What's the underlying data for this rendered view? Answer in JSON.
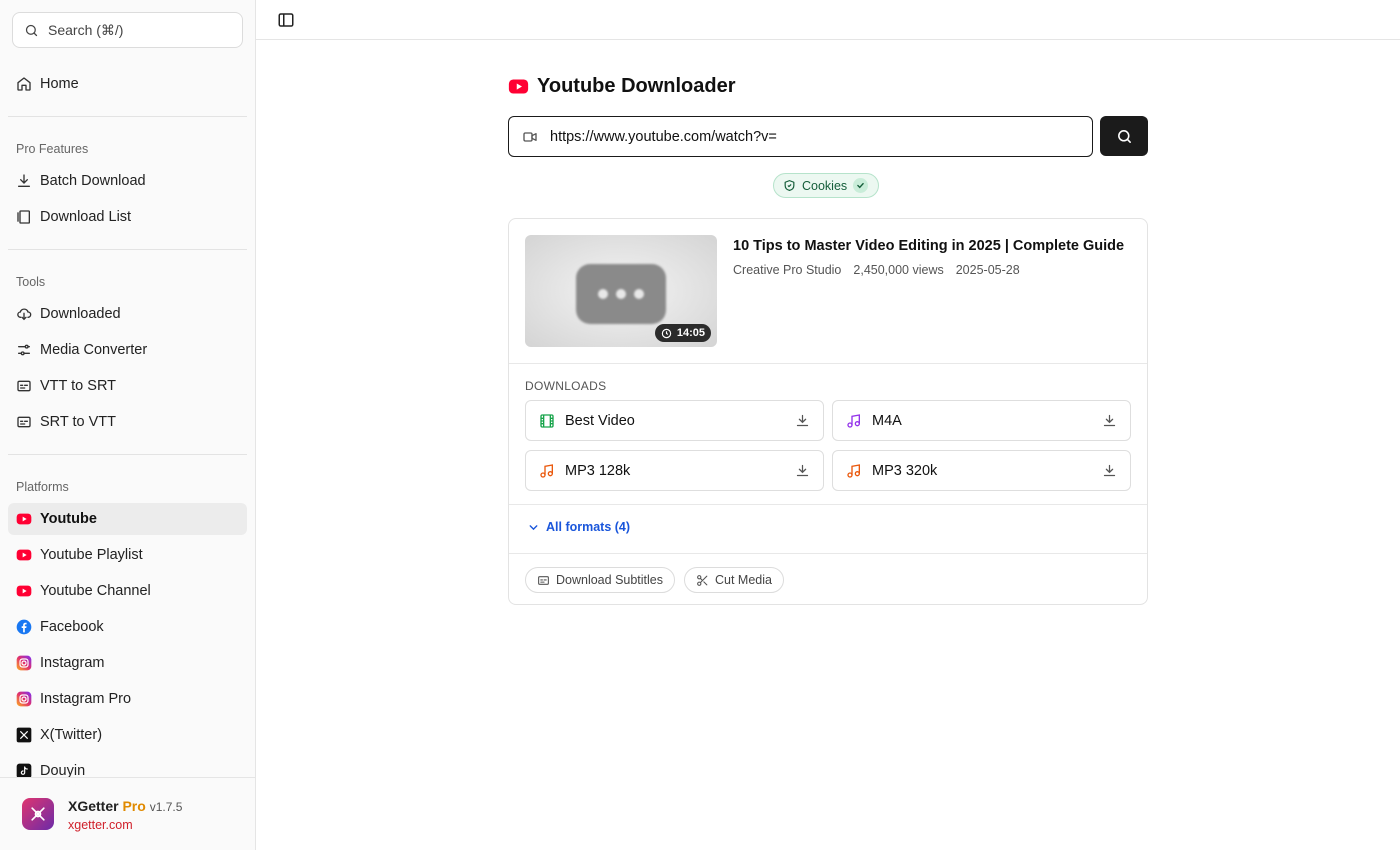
{
  "sidebar": {
    "search_placeholder": "Search (⌘/)",
    "home": "Home",
    "pro_features_label": "Pro Features",
    "pro_items": [
      "Batch Download",
      "Download List"
    ],
    "tools_label": "Tools",
    "tool_items": [
      "Downloaded",
      "Media Converter",
      "VTT to SRT",
      "SRT to VTT"
    ],
    "platforms_label": "Platforms",
    "platform_items": [
      "Youtube",
      "Youtube Playlist",
      "Youtube Channel",
      "Facebook",
      "Instagram",
      "Instagram Pro",
      "X(Twitter)",
      "Douyin"
    ],
    "active_item": "Youtube"
  },
  "footer": {
    "app_name": "XGetter",
    "pro": "Pro",
    "version": "v1.7.5",
    "url": "xgetter.com"
  },
  "main": {
    "title": "Youtube Downloader",
    "url_value": "https://www.youtube.com/watch?v=",
    "cookies_label": "Cookies",
    "video": {
      "title": "10 Tips to Master Video Editing in 2025 | Complete Guide",
      "channel": "Creative Pro Studio",
      "views": "2,450,000 views",
      "date": "2025-05-28",
      "duration": "14:05"
    },
    "downloads_label": "DOWNLOADS",
    "downloads": [
      {
        "label": "Best Video",
        "icon": "film-icon",
        "color": "#16a34a"
      },
      {
        "label": "M4A",
        "icon": "music-icon",
        "color": "#9333ea"
      },
      {
        "label": "MP3 128k",
        "icon": "music-icon",
        "color": "#ea580c"
      },
      {
        "label": "MP3 320k",
        "icon": "music-icon",
        "color": "#ea580c"
      }
    ],
    "all_formats": "All formats (4)",
    "download_subtitles": "Download Subtitles",
    "cut_media": "Cut Media"
  },
  "colors": {
    "youtube_red": "#ff0033",
    "link_blue": "#1a56db",
    "cookies_green": "#155e3a",
    "pro_orange": "#e08a00"
  }
}
